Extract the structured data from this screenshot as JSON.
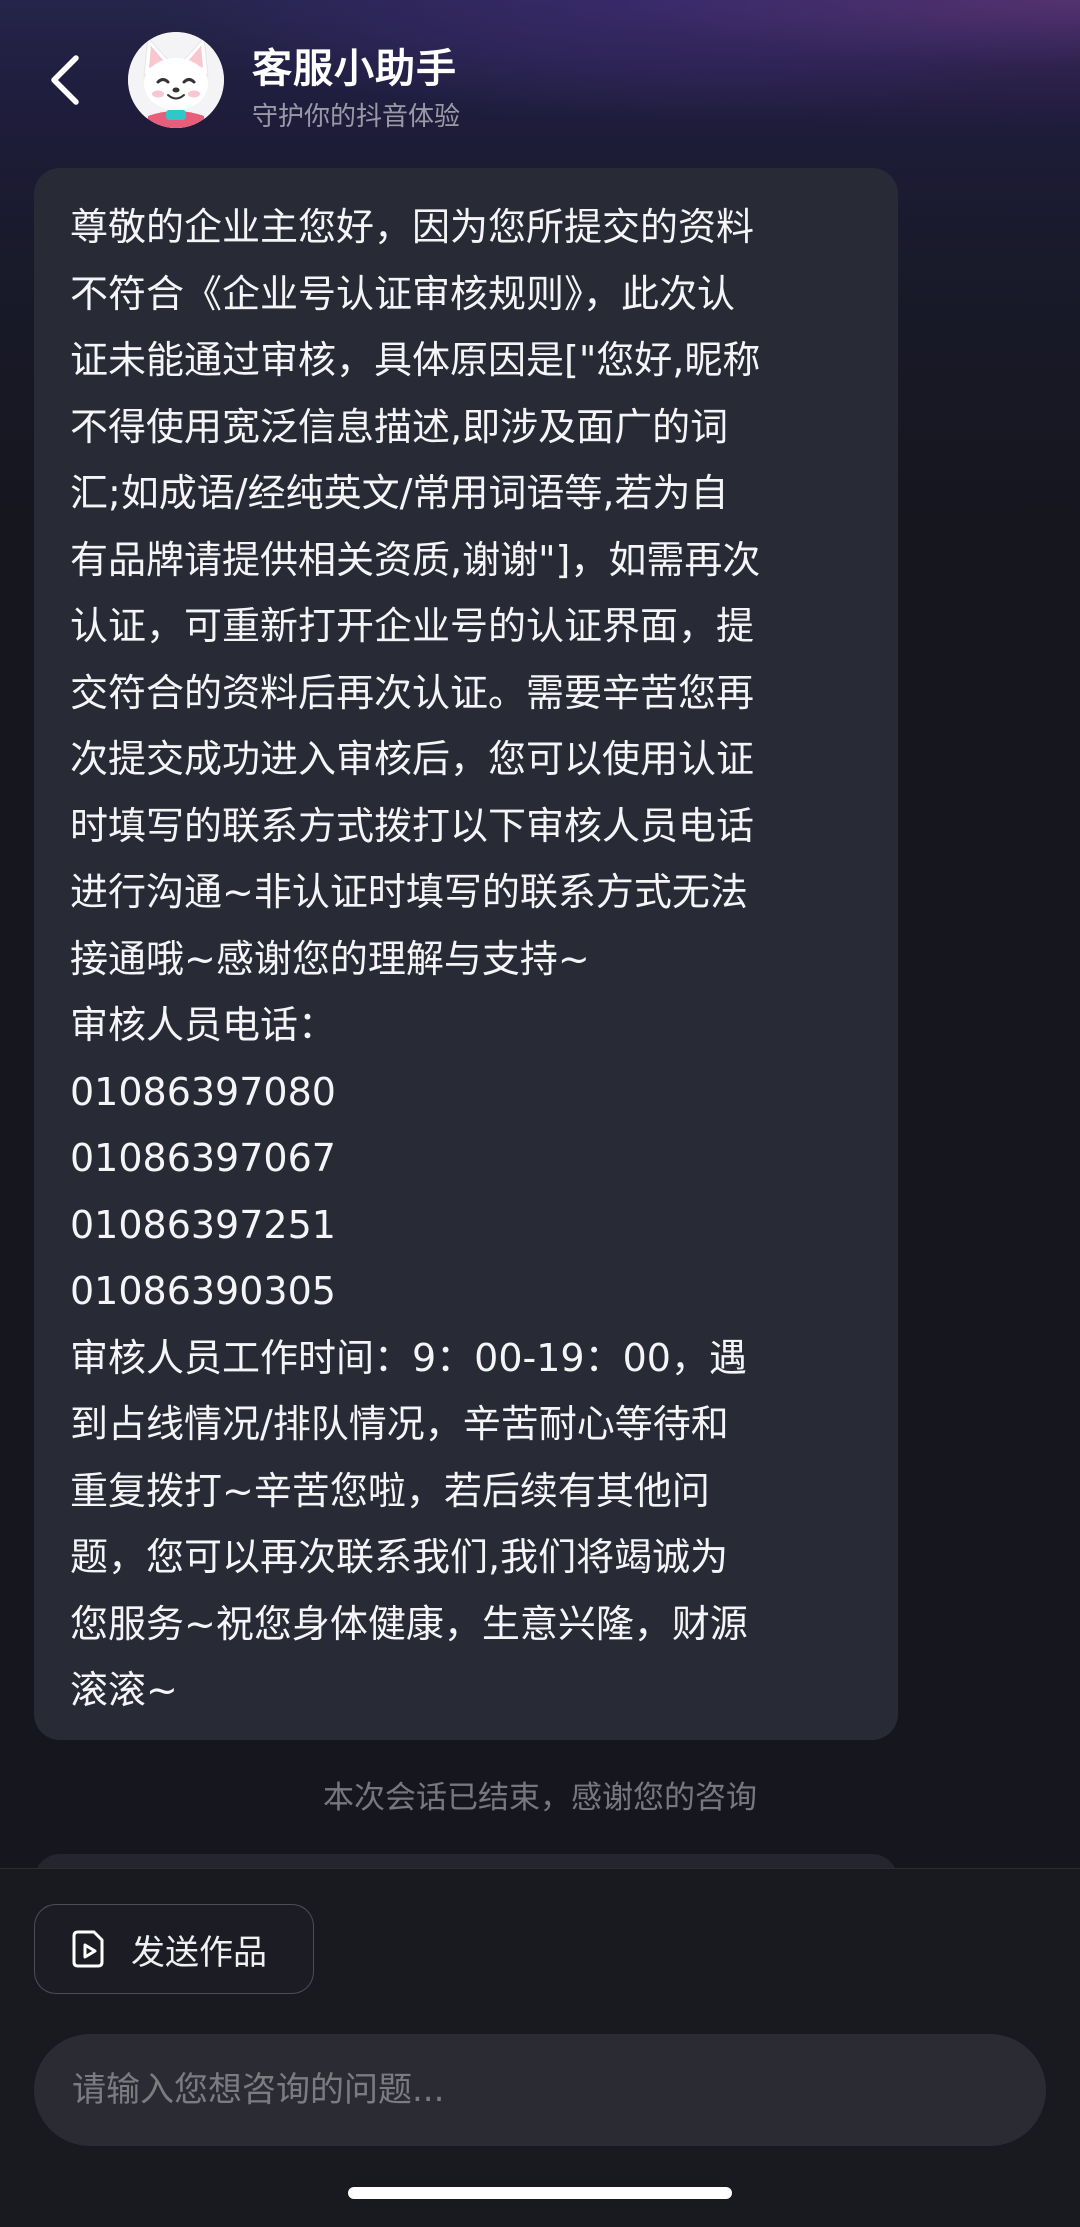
{
  "header": {
    "back_icon": "chevron-left-icon",
    "avatar_icon": "white-cat-mascot-icon",
    "title": "客服小助手",
    "subtitle": "守护你的抖音体验"
  },
  "message": {
    "lines": [
      "尊敬的企业主您好，因为您所提交的资料",
      "不符合《企业号认证审核规则》，此次认",
      "证未能通过审核，具体原因是[\"您好,昵称",
      "不得使用宽泛信息描述,即涉及面广的词",
      "汇;如成语/经纯英文/常用词语等,若为自",
      "有品牌请提供相关资质,谢谢\"]，如需再次",
      "认证，可重新打开企业号的认证界面，提",
      "交符合的资料后再次认证。需要辛苦您再",
      "次提交成功进入审核后，您可以使用认证",
      "时填写的联系方式拨打以下审核人员电话",
      "进行沟通~非认证时填写的联系方式无法",
      "接通哦~感谢您的理解与支持~",
      "审核人员电话：",
      "01086397080",
      "01086397067",
      "01086397251",
      "01086390305",
      "审核人员工作时间：9：00-19：00，遇",
      "到占线情况/排队情况，辛苦耐心等待和",
      "重复拨打~辛苦您啦，若后续有其他问",
      "题，您可以再次联系我们,我们将竭诚为",
      "您服务~祝您身体健康，生意兴隆，财源",
      "滚滚~"
    ]
  },
  "session_end_text": "本次会话已结束，感谢您的咨询",
  "actions": {
    "send_work_icon": "video-file-icon",
    "send_work_label": "发送作品"
  },
  "input": {
    "placeholder": "请输入您想咨询的问题...",
    "value": ""
  },
  "colors": {
    "background": "#16161f",
    "bubble": "#282a36",
    "input_bg": "#2a2b33",
    "text_primary": "#f5f5f7"
  }
}
